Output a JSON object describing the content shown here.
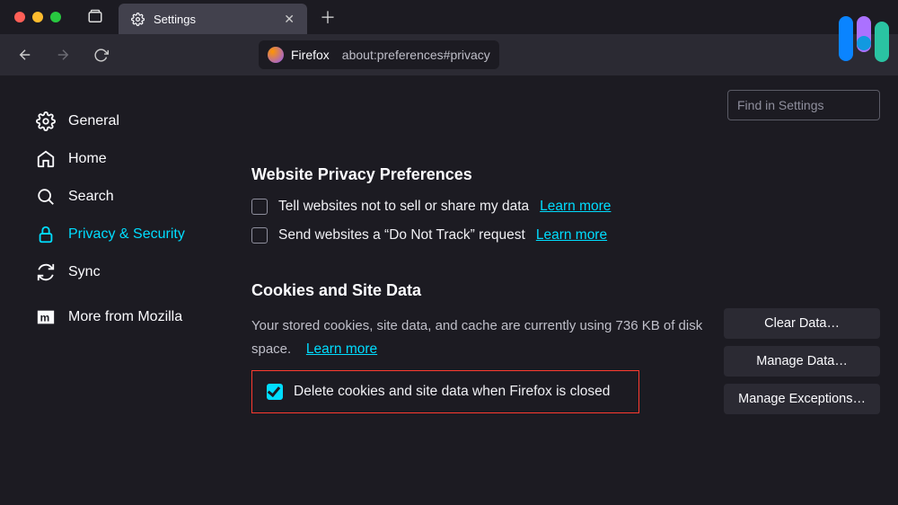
{
  "titlebar": {
    "tab_label": "Settings",
    "tab_icon": "gear-icon"
  },
  "navbar": {
    "identity_label": "Firefox",
    "url": "about:preferences#privacy"
  },
  "search": {
    "placeholder": "Find in Settings"
  },
  "sidebar": {
    "items": [
      {
        "label": "General",
        "icon": "gear-icon",
        "active": false
      },
      {
        "label": "Home",
        "icon": "home-icon",
        "active": false
      },
      {
        "label": "Search",
        "icon": "search-icon",
        "active": false
      },
      {
        "label": "Privacy & Security",
        "icon": "lock-icon",
        "active": true
      },
      {
        "label": "Sync",
        "icon": "sync-icon",
        "active": false
      },
      {
        "label": "More from Mozilla",
        "icon": "mozilla-icon",
        "active": false
      }
    ]
  },
  "privacy_prefs": {
    "heading": "Website Privacy Preferences",
    "row1_label": "Tell websites not to sell or share my data",
    "row1_link": "Learn more",
    "row2_label": "Send websites a “Do Not Track” request",
    "row2_link": "Learn more"
  },
  "cookies": {
    "heading": "Cookies and Site Data",
    "usage_text": "Your stored cookies, site data, and cache are currently using 736 KB of disk space.",
    "usage_link": "Learn more",
    "delete_label": "Delete cookies and site data when Firefox is closed",
    "buttons": {
      "clear": "Clear Data…",
      "manage": "Manage Data…",
      "exceptions": "Manage Exceptions…"
    }
  }
}
